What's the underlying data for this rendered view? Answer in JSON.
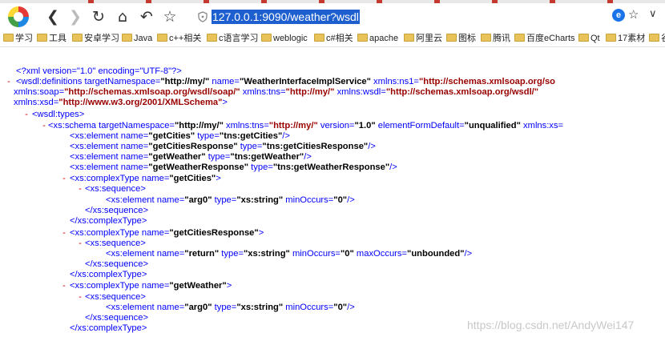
{
  "browser": {
    "url": "127.0.0.1:9090/weather?wsdl",
    "nav": {
      "back": "❮",
      "forward": "❯",
      "reload": "↻",
      "home": "⌂",
      "undo": "↶",
      "star": "☆"
    },
    "url_right": {
      "badge": "e",
      "star": "☆",
      "chevron": "∨"
    }
  },
  "bookmarks": [
    "学习",
    "工具",
    "安卓学习",
    "Java",
    "c++相关",
    "c语言学习",
    "weblogic",
    "c#相关",
    "apache",
    "阿里云",
    "图标",
    "腾讯",
    "百度eCharts",
    "Qt",
    "17素材",
    "谷"
  ],
  "xml_lines": [
    {
      "toggle": "",
      "segments": [
        {
          "t": "<?xml version=\"1.0\" encoding=\"UTF-8\"?>",
          "k": "p"
        }
      ]
    },
    {
      "toggle": "-",
      "segments": [
        {
          "t": "<wsdl:definitions targetNamespace=",
          "k": "a"
        },
        {
          "t": "\"http://my/\"",
          "k": "v"
        },
        {
          "t": " name=",
          "k": "a"
        },
        {
          "t": "\"WeatherInterfaceImplService\"",
          "k": "v"
        },
        {
          "t": " xmlns:ns1=",
          "k": "a"
        },
        {
          "t": "\"http://schemas.xmlsoap.org/so",
          "k": "ns"
        }
      ]
    },
    {
      "toggle": "",
      "segments": [
        {
          "t": "xmlns:soap=",
          "k": "a"
        },
        {
          "t": "\"http://schemas.xmlsoap.org/wsdl/soap/\"",
          "k": "ns"
        },
        {
          "t": " xmlns:tns=",
          "k": "a"
        },
        {
          "t": "\"http://my/\"",
          "k": "ns"
        },
        {
          "t": " xmlns:wsdl=",
          "k": "a"
        },
        {
          "t": "\"http://schemas.xmlsoap.org/wsdl/\"",
          "k": "ns"
        }
      ]
    },
    {
      "toggle": "",
      "segments": [
        {
          "t": "xmlns:xsd=",
          "k": "a"
        },
        {
          "t": "\"http://www.w3.org/2001/XMLSchema\"",
          "k": "ns"
        },
        {
          "t": ">",
          "k": "a"
        }
      ]
    },
    {
      "toggle": "-",
      "segments": [
        {
          "t": "<wsdl:types>",
          "k": "a"
        }
      ]
    },
    {
      "toggle": "-",
      "segments": [
        {
          "t": "<xs:schema targetNamespace=",
          "k": "a"
        },
        {
          "t": "\"http://my/\"",
          "k": "v"
        },
        {
          "t": " xmlns:tns=",
          "k": "a"
        },
        {
          "t": "\"http://my/\"",
          "k": "ns"
        },
        {
          "t": " version=",
          "k": "a"
        },
        {
          "t": "\"1.0\"",
          "k": "v"
        },
        {
          "t": " elementFormDefault=",
          "k": "a"
        },
        {
          "t": "\"unqualified\"",
          "k": "v"
        },
        {
          "t": " xmlns:xs=",
          "k": "a"
        }
      ]
    },
    {
      "toggle": "",
      "segments": [
        {
          "t": "<xs:element name=",
          "k": "a"
        },
        {
          "t": "\"getCities\"",
          "k": "v"
        },
        {
          "t": " type=",
          "k": "a"
        },
        {
          "t": "\"tns:getCities\"",
          "k": "v"
        },
        {
          "t": "/>",
          "k": "a"
        }
      ]
    },
    {
      "toggle": "",
      "segments": [
        {
          "t": "<xs:element name=",
          "k": "a"
        },
        {
          "t": "\"getCitiesResponse\"",
          "k": "v"
        },
        {
          "t": " type=",
          "k": "a"
        },
        {
          "t": "\"tns:getCitiesResponse\"",
          "k": "v"
        },
        {
          "t": "/>",
          "k": "a"
        }
      ]
    },
    {
      "toggle": "",
      "segments": [
        {
          "t": "<xs:element name=",
          "k": "a"
        },
        {
          "t": "\"getWeather\"",
          "k": "v"
        },
        {
          "t": " type=",
          "k": "a"
        },
        {
          "t": "\"tns:getWeather\"",
          "k": "v"
        },
        {
          "t": "/>",
          "k": "a"
        }
      ]
    },
    {
      "toggle": "",
      "segments": [
        {
          "t": "<xs:element name=",
          "k": "a"
        },
        {
          "t": "\"getWeatherResponse\"",
          "k": "v"
        },
        {
          "t": " type=",
          "k": "a"
        },
        {
          "t": "\"tns:getWeatherResponse\"",
          "k": "v"
        },
        {
          "t": "/>",
          "k": "a"
        }
      ]
    },
    {
      "toggle": "-",
      "segments": [
        {
          "t": "<xs:complexType name=",
          "k": "a"
        },
        {
          "t": "\"getCities\"",
          "k": "v"
        },
        {
          "t": ">",
          "k": "a"
        }
      ]
    },
    {
      "toggle": "-",
      "segments": [
        {
          "t": "<xs:sequence>",
          "k": "a"
        }
      ]
    },
    {
      "toggle": "",
      "segments": [
        {
          "t": "<xs:element name=",
          "k": "a"
        },
        {
          "t": "\"arg0\"",
          "k": "v"
        },
        {
          "t": " type=",
          "k": "a"
        },
        {
          "t": "\"xs:string\"",
          "k": "v"
        },
        {
          "t": " minOccurs=",
          "k": "a"
        },
        {
          "t": "\"0\"",
          "k": "v"
        },
        {
          "t": "/>",
          "k": "a"
        }
      ]
    },
    {
      "toggle": "",
      "segments": [
        {
          "t": "</xs:sequence>",
          "k": "a"
        }
      ]
    },
    {
      "toggle": "",
      "segments": [
        {
          "t": "</xs:complexType>",
          "k": "a"
        }
      ]
    },
    {
      "toggle": "-",
      "segments": [
        {
          "t": "<xs:complexType name=",
          "k": "a"
        },
        {
          "t": "\"getCitiesResponse\"",
          "k": "v"
        },
        {
          "t": ">",
          "k": "a"
        }
      ]
    },
    {
      "toggle": "-",
      "segments": [
        {
          "t": "<xs:sequence>",
          "k": "a"
        }
      ]
    },
    {
      "toggle": "",
      "segments": [
        {
          "t": "<xs:element name=",
          "k": "a"
        },
        {
          "t": "\"return\"",
          "k": "v"
        },
        {
          "t": " type=",
          "k": "a"
        },
        {
          "t": "\"xs:string\"",
          "k": "v"
        },
        {
          "t": " minOccurs=",
          "k": "a"
        },
        {
          "t": "\"0\"",
          "k": "v"
        },
        {
          "t": " maxOccurs=",
          "k": "a"
        },
        {
          "t": "\"unbounded\"",
          "k": "v"
        },
        {
          "t": "/>",
          "k": "a"
        }
      ]
    },
    {
      "toggle": "",
      "segments": [
        {
          "t": "</xs:sequence>",
          "k": "a"
        }
      ]
    },
    {
      "toggle": "",
      "segments": [
        {
          "t": "</xs:complexType>",
          "k": "a"
        }
      ]
    },
    {
      "toggle": "-",
      "segments": [
        {
          "t": "<xs:complexType name=",
          "k": "a"
        },
        {
          "t": "\"getWeather\"",
          "k": "v"
        },
        {
          "t": ">",
          "k": "a"
        }
      ]
    },
    {
      "toggle": "-",
      "segments": [
        {
          "t": "<xs:sequence>",
          "k": "a"
        }
      ]
    },
    {
      "toggle": "",
      "segments": [
        {
          "t": "<xs:element name=",
          "k": "a"
        },
        {
          "t": "\"arg0\"",
          "k": "v"
        },
        {
          "t": " type=",
          "k": "a"
        },
        {
          "t": "\"xs:string\"",
          "k": "v"
        },
        {
          "t": " minOccurs=",
          "k": "a"
        },
        {
          "t": "\"0\"",
          "k": "v"
        },
        {
          "t": "/>",
          "k": "a"
        }
      ]
    },
    {
      "toggle": "",
      "segments": [
        {
          "t": "</xs:sequence>",
          "k": "a"
        }
      ]
    },
    {
      "toggle": "",
      "segments": [
        {
          "t": "</xs:complexType>",
          "k": "a"
        }
      ]
    }
  ],
  "watermark": "https://blog.csdn.net/AndyWei147",
  "colors": {
    "attr": "#0000ff",
    "value": "#000000",
    "namespace": "#990000",
    "toggle": "#cc0000",
    "url_highlight": "#1e5fd0"
  }
}
